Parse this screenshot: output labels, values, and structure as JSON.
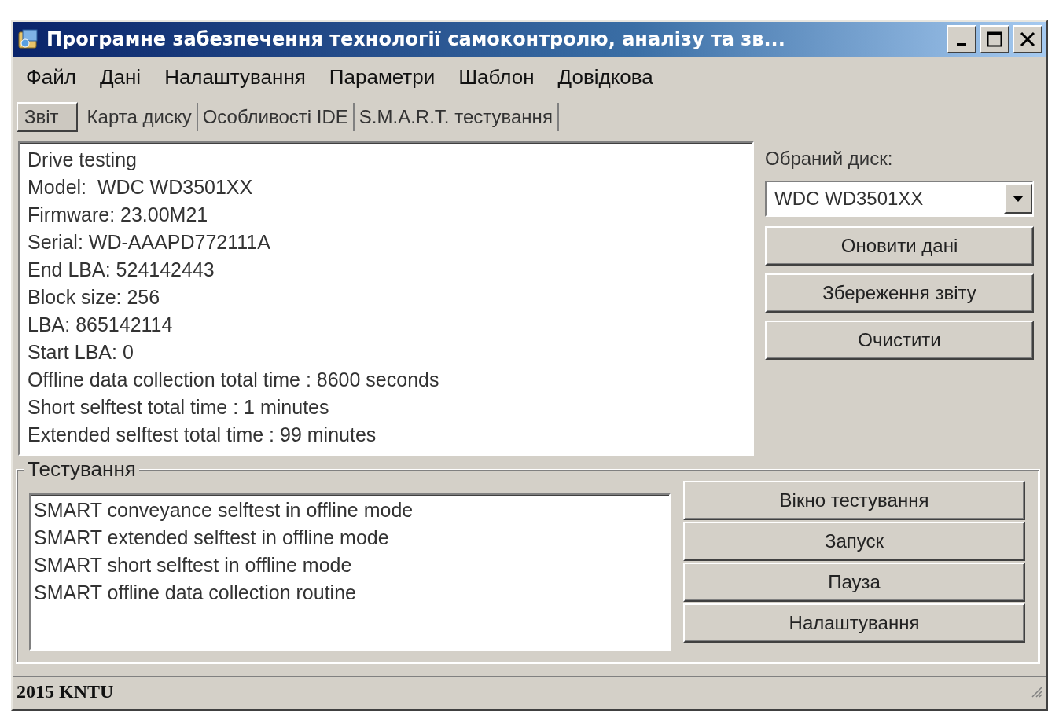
{
  "window": {
    "title": "Програмне забезпечення технології самоконтролю, аналізу та зв..."
  },
  "menu": [
    "Файл",
    "Дані",
    "Налаштування",
    "Параметри",
    "Шаблон",
    "Довідкова"
  ],
  "tabs": [
    {
      "label": "Звіт",
      "selected": true
    },
    {
      "label": "Карта диску",
      "selected": false
    },
    {
      "label": "Особливості IDE",
      "selected": false
    },
    {
      "label": "S.M.A.R.T. тестування",
      "selected": false
    }
  ],
  "report": {
    "lines": [
      "Drive testing",
      "Model:  WDC WD3501XX",
      "Firmware: 23.00M21",
      "Serial: WD-AAAPD772111A",
      "End LBA: 524142443",
      "Block size: 256",
      "LBA: 865142114",
      "Start LBA: 0",
      "Offline data collection total time : 8600 seconds",
      "Short selftest total time : 1 minutes",
      "Extended selftest total time : 99 minutes"
    ]
  },
  "disk": {
    "label": "Обраний диск:",
    "value": "WDC WD3501XX"
  },
  "side_buttons": [
    "Оновити дані",
    "Збереження звіту",
    "Очистити"
  ],
  "testing": {
    "title": "Тестування",
    "tests": [
      "SMART conveyance selftest in offline mode",
      "SMART extended selftest in offline mode",
      "SMART short selftest in offline mode",
      "SMART offline data collection routine"
    ],
    "buttons": [
      "Вікно тестування",
      "Запуск",
      "Пауза",
      "Налаштування"
    ]
  },
  "status_bar": "2015 KNTU"
}
